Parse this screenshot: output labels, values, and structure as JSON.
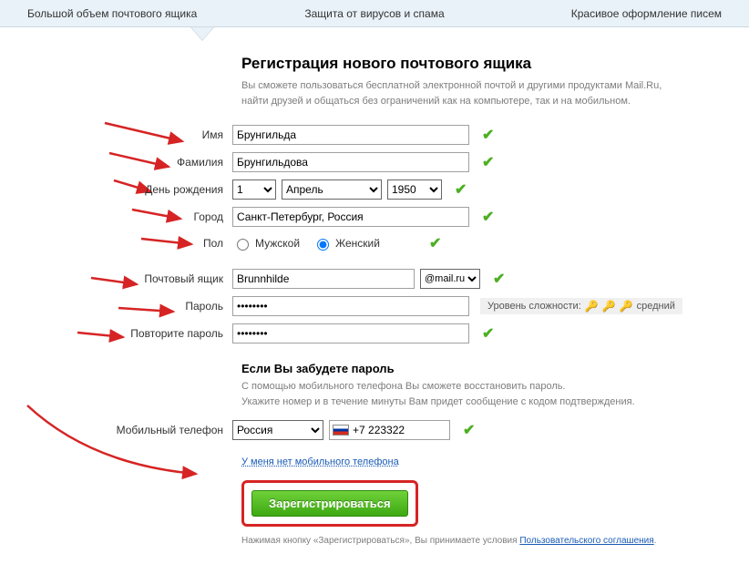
{
  "tabs": {
    "t1": "Большой объем почтового ящика",
    "t2": "Защита от вирусов и спама",
    "t3": "Красивое оформление писем"
  },
  "heading": "Регистрация нового почтового ящика",
  "subheading": "Вы сможете пользоваться бесплатной электронной почтой и другими продуктами Mail.Ru,\nнайти друзей и общаться без ограничений как на компьютере, так и на мобильном.",
  "labels": {
    "firstname": "Имя",
    "lastname": "Фамилия",
    "birthday": "День рождения",
    "city": "Город",
    "gender": "Пол",
    "mailbox": "Почтовый ящик",
    "password": "Пароль",
    "password2": "Повторите пароль",
    "phone": "Мобильный телефон"
  },
  "values": {
    "firstname": "Брунгильда",
    "lastname": "Брунгильдова",
    "day": "1",
    "month": "Апрель",
    "year": "1950",
    "city": "Санкт-Петербург, Россия",
    "mailbox": "Brunnhilde",
    "domain": "@mail.ru",
    "password": "••••••••",
    "password2": "••••••••",
    "country": "Россия",
    "phone": "+7 223322"
  },
  "gender": {
    "male": "Мужской",
    "female": "Женский"
  },
  "strength": {
    "label": "Уровень сложности:",
    "level": "средний"
  },
  "forgot": {
    "title": "Если Вы забудете пароль",
    "sub": "С помощью мобильного телефона Вы сможете восстановить пароль.\nУкажите номер и в течение минуты Вам придет сообщение с кодом подтверждения."
  },
  "no_phone": "У меня нет мобильного телефона",
  "register": "Зарегистрироваться",
  "terms_pre": "Нажимая кнопку «Зарегистрироваться», Вы принимаете условия ",
  "terms_link": "Пользовательского соглашения"
}
